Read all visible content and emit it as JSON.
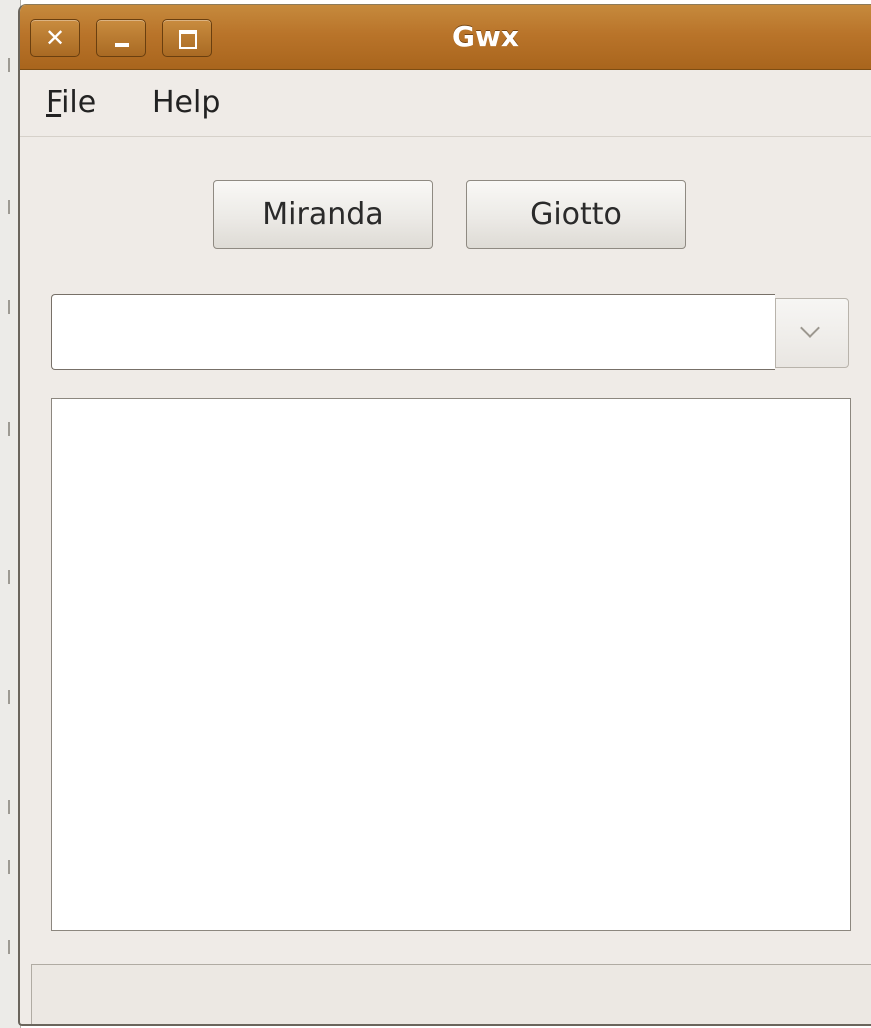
{
  "window": {
    "title": "Gwx",
    "close_glyph": "✕"
  },
  "menubar": {
    "items": [
      {
        "label_first": "F",
        "label_rest": "ile"
      },
      {
        "label": "Help"
      }
    ]
  },
  "buttons": {
    "miranda_label": "Miranda",
    "giotto_label": "Giotto"
  },
  "combo": {
    "value": ""
  },
  "text_area": {
    "value": ""
  },
  "status_bar": {
    "text": ""
  },
  "colors": {
    "titlebar": "#b9742a",
    "window_bg": "#efebe7"
  }
}
